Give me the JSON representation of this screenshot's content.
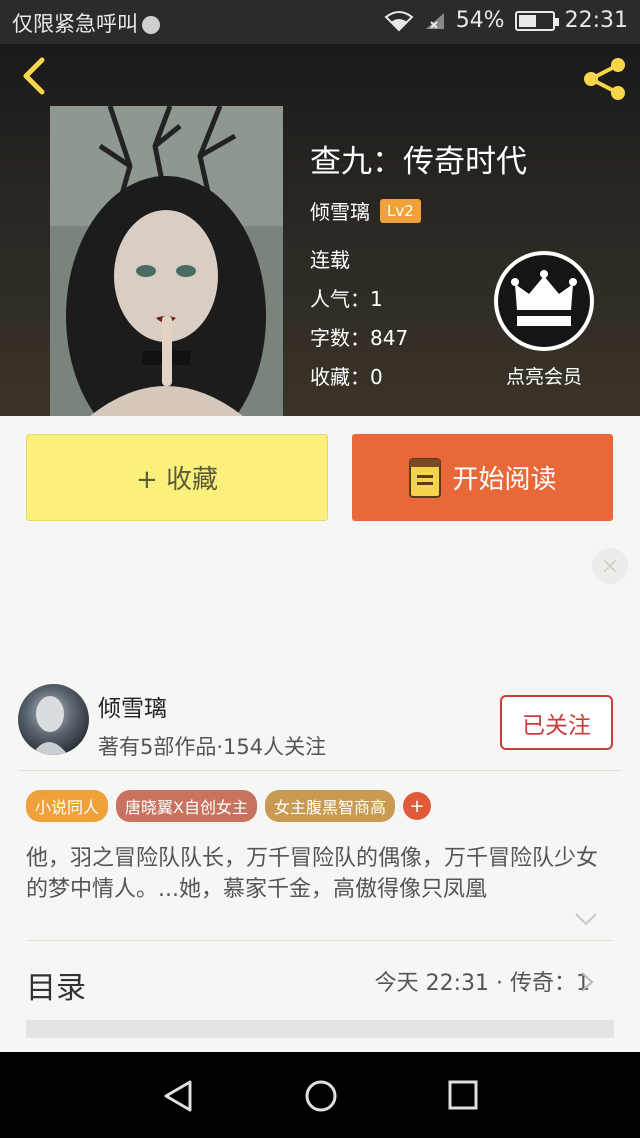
{
  "status_bar": {
    "carrier_text": "仅限紧急呼叫",
    "battery": "54%",
    "battery_level": 0.54,
    "time": "22:31"
  },
  "book": {
    "title": "查九：传奇时代",
    "author": "倾雪璃",
    "level": "Lv2",
    "status": "连载",
    "popularity": "人气：1",
    "word_count": "字数：847",
    "favorites": "收藏：0"
  },
  "vip": {
    "label": "点亮会员"
  },
  "actions": {
    "collect_label": "+ 收藏",
    "read_label": "开始阅读"
  },
  "author_card": {
    "name": "倾雪璃",
    "stats": "著有5部作品·154人关注",
    "follow_label": "已关注"
  },
  "tags": [
    {
      "label": "小说同人",
      "color": "#f0a13a"
    },
    {
      "label": "唐晓翼X自创女主",
      "color": "#c9725f"
    },
    {
      "label": "女主腹黑智商高",
      "color": "#c99b52"
    }
  ],
  "tag_add": "+",
  "description": "他，羽之冒险队队长，万千冒险队的偶像，万千冒险队少女的梦中情人。...她，慕家千金，高傲得像只凤凰",
  "toc": {
    "title": "目录",
    "latest": "今天 22:31 · 传奇：1"
  },
  "icons": {
    "back": "chevron-left-icon",
    "share": "share-icon",
    "crown": "crown-icon",
    "book": "book-icon",
    "close": "close-icon",
    "expand": "chevron-down-icon",
    "nav_back": "triangle-back-icon",
    "nav_home": "circle-home-icon",
    "nav_recent": "square-recent-icon"
  },
  "colors": {
    "accent_orange": "#e8683a",
    "collect_yellow": "#fbf07c",
    "follow_red": "#cc3b3b",
    "back_yellow": "#f7d64b"
  }
}
